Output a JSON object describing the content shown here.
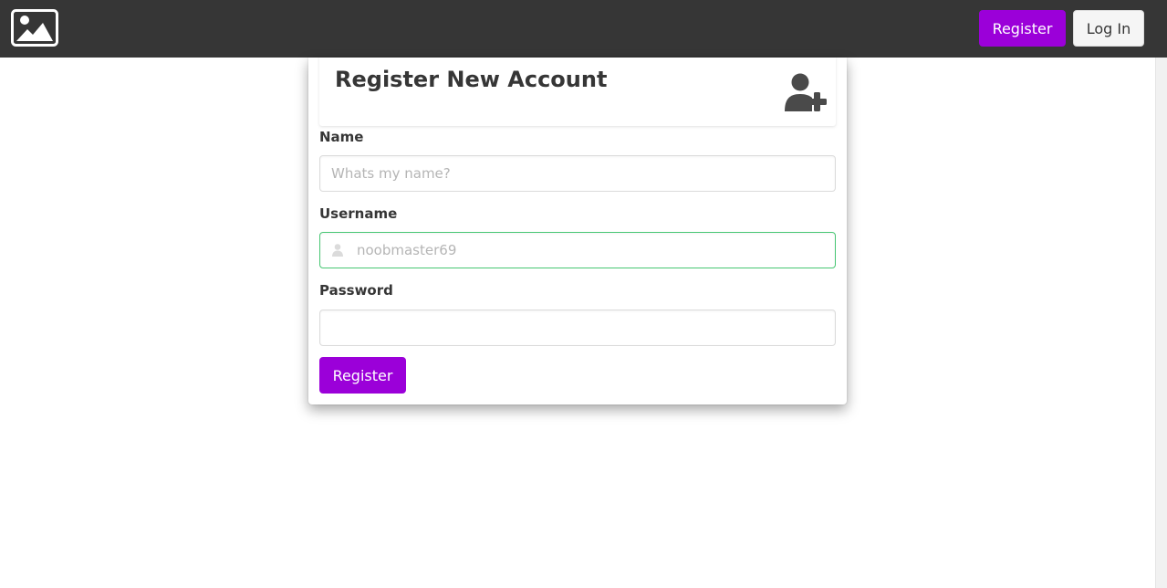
{
  "nav": {
    "logo_icon": "image-icon",
    "register_label": "Register",
    "login_label": "Log In"
  },
  "form": {
    "title": "Register New Account",
    "header_icon": "user-plus-icon",
    "name": {
      "label": "Name",
      "placeholder": "Whats my name?",
      "value": ""
    },
    "username": {
      "label": "Username",
      "placeholder": "noobmaster69",
      "value": "",
      "icon": "user-icon"
    },
    "password": {
      "label": "Password",
      "placeholder": "",
      "value": ""
    },
    "submit_label": "Register"
  },
  "colors": {
    "navbar": "#363636",
    "primary": "#9b00d9",
    "success_border": "#48c774",
    "text": "#363636",
    "placeholder": "#b5b5b5"
  }
}
